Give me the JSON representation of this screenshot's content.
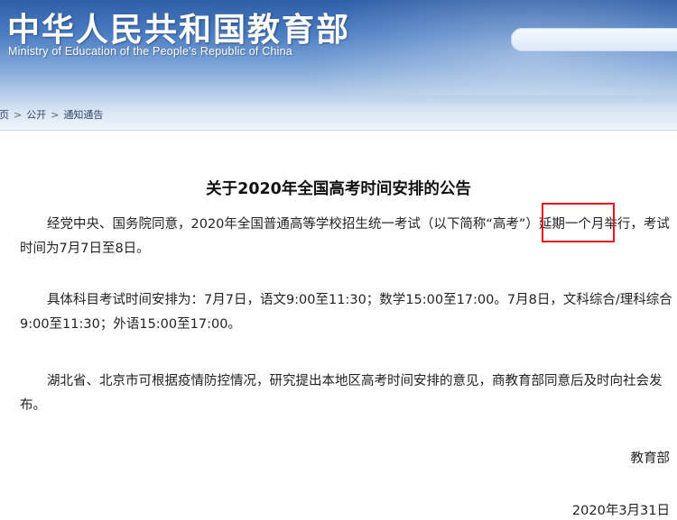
{
  "header": {
    "site_title": "中华人民共和国教育部",
    "site_subtitle": "Ministry of Education of the People's Republic of China"
  },
  "breadcrumb": {
    "items": [
      "首页",
      "公开",
      "通知通告"
    ],
    "separator": ">"
  },
  "article": {
    "title": "关于2020年全国高考时间安排的公告",
    "paragraphs": [
      "经党中央、国务院同意，2020年全国普通高等学校招生统一考试（以下简称“高考”）延期一个月举行，考试时间为7月7日至8日。",
      "具体科目考试时间安排为：7月7日，语文9:00至11:30；数学15:00至17:00。7月8日，文科综合/理科综合9:00至11:30；外语15:00至17:00。",
      "湖北省、北京市可根据疫情防控情况，研究提出本地区高考时间安排的意见，商教育部同意后及时向社会发布。"
    ],
    "signer": "教育部",
    "date": "2020年3月31日"
  },
  "colors": {
    "banner_blue": "#2f5fa6",
    "highlight_red": "#e8141b"
  }
}
